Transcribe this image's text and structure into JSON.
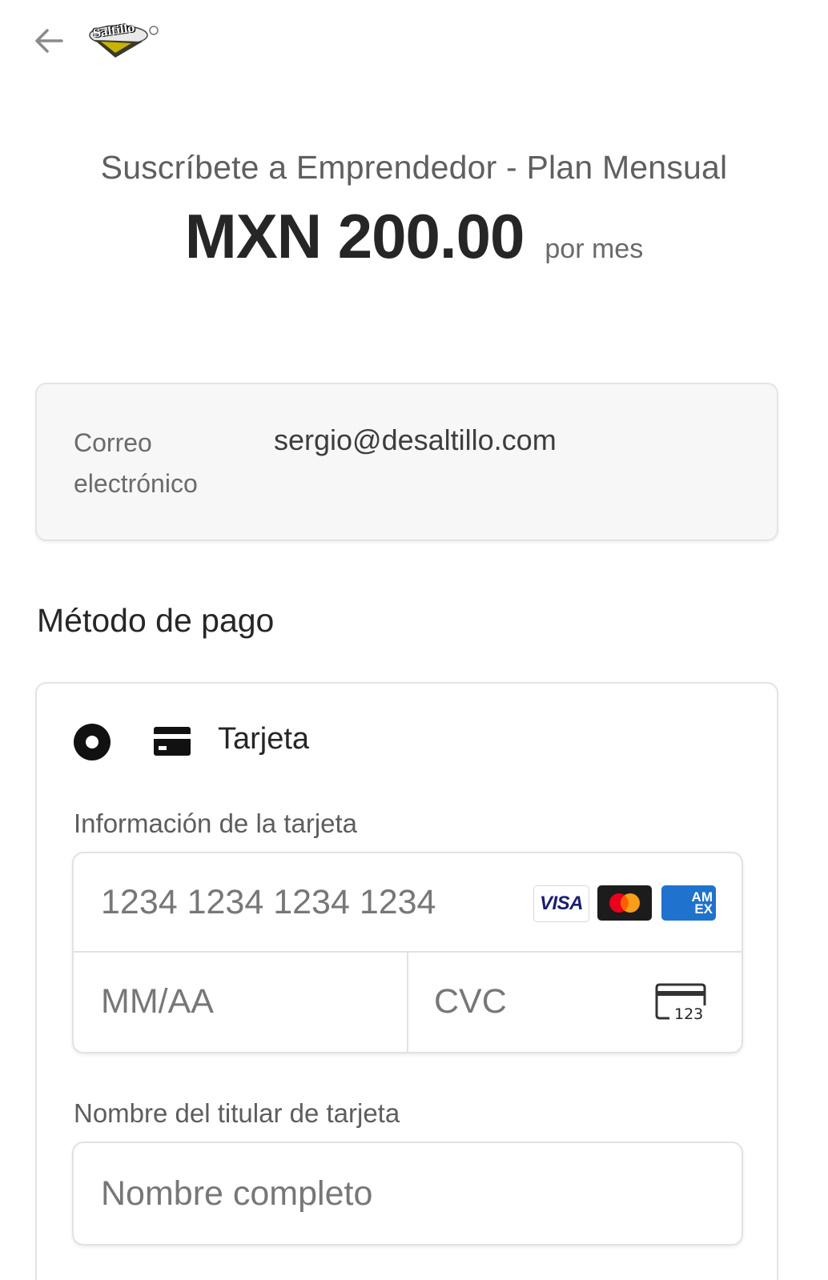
{
  "header": {
    "back_icon": "arrow-left-icon",
    "logo_text": "Saltillo"
  },
  "checkout": {
    "title": "Suscríbete a Emprendedor - Plan Mensual",
    "price": "MXN 200.00",
    "period": "por mes"
  },
  "email": {
    "label": "Correo electrónico",
    "value": "sergio@desaltillo.com"
  },
  "payment": {
    "heading": "Método de pago",
    "method_label": "Tarjeta",
    "method_icon": "credit-card-icon",
    "card_info_label": "Información de la tarjeta",
    "card_number_placeholder": "1234 1234 1234 1234",
    "expiry_placeholder": "MM/AA",
    "cvc_placeholder": "CVC",
    "cvc_icon_text": "123",
    "brands": {
      "visa": "VISA",
      "mastercard": "mastercard-logo",
      "amex_line1": "AM",
      "amex_line2": "EX"
    },
    "holder_label": "Nombre del titular de tarjeta",
    "holder_placeholder": "Nombre completo"
  }
}
